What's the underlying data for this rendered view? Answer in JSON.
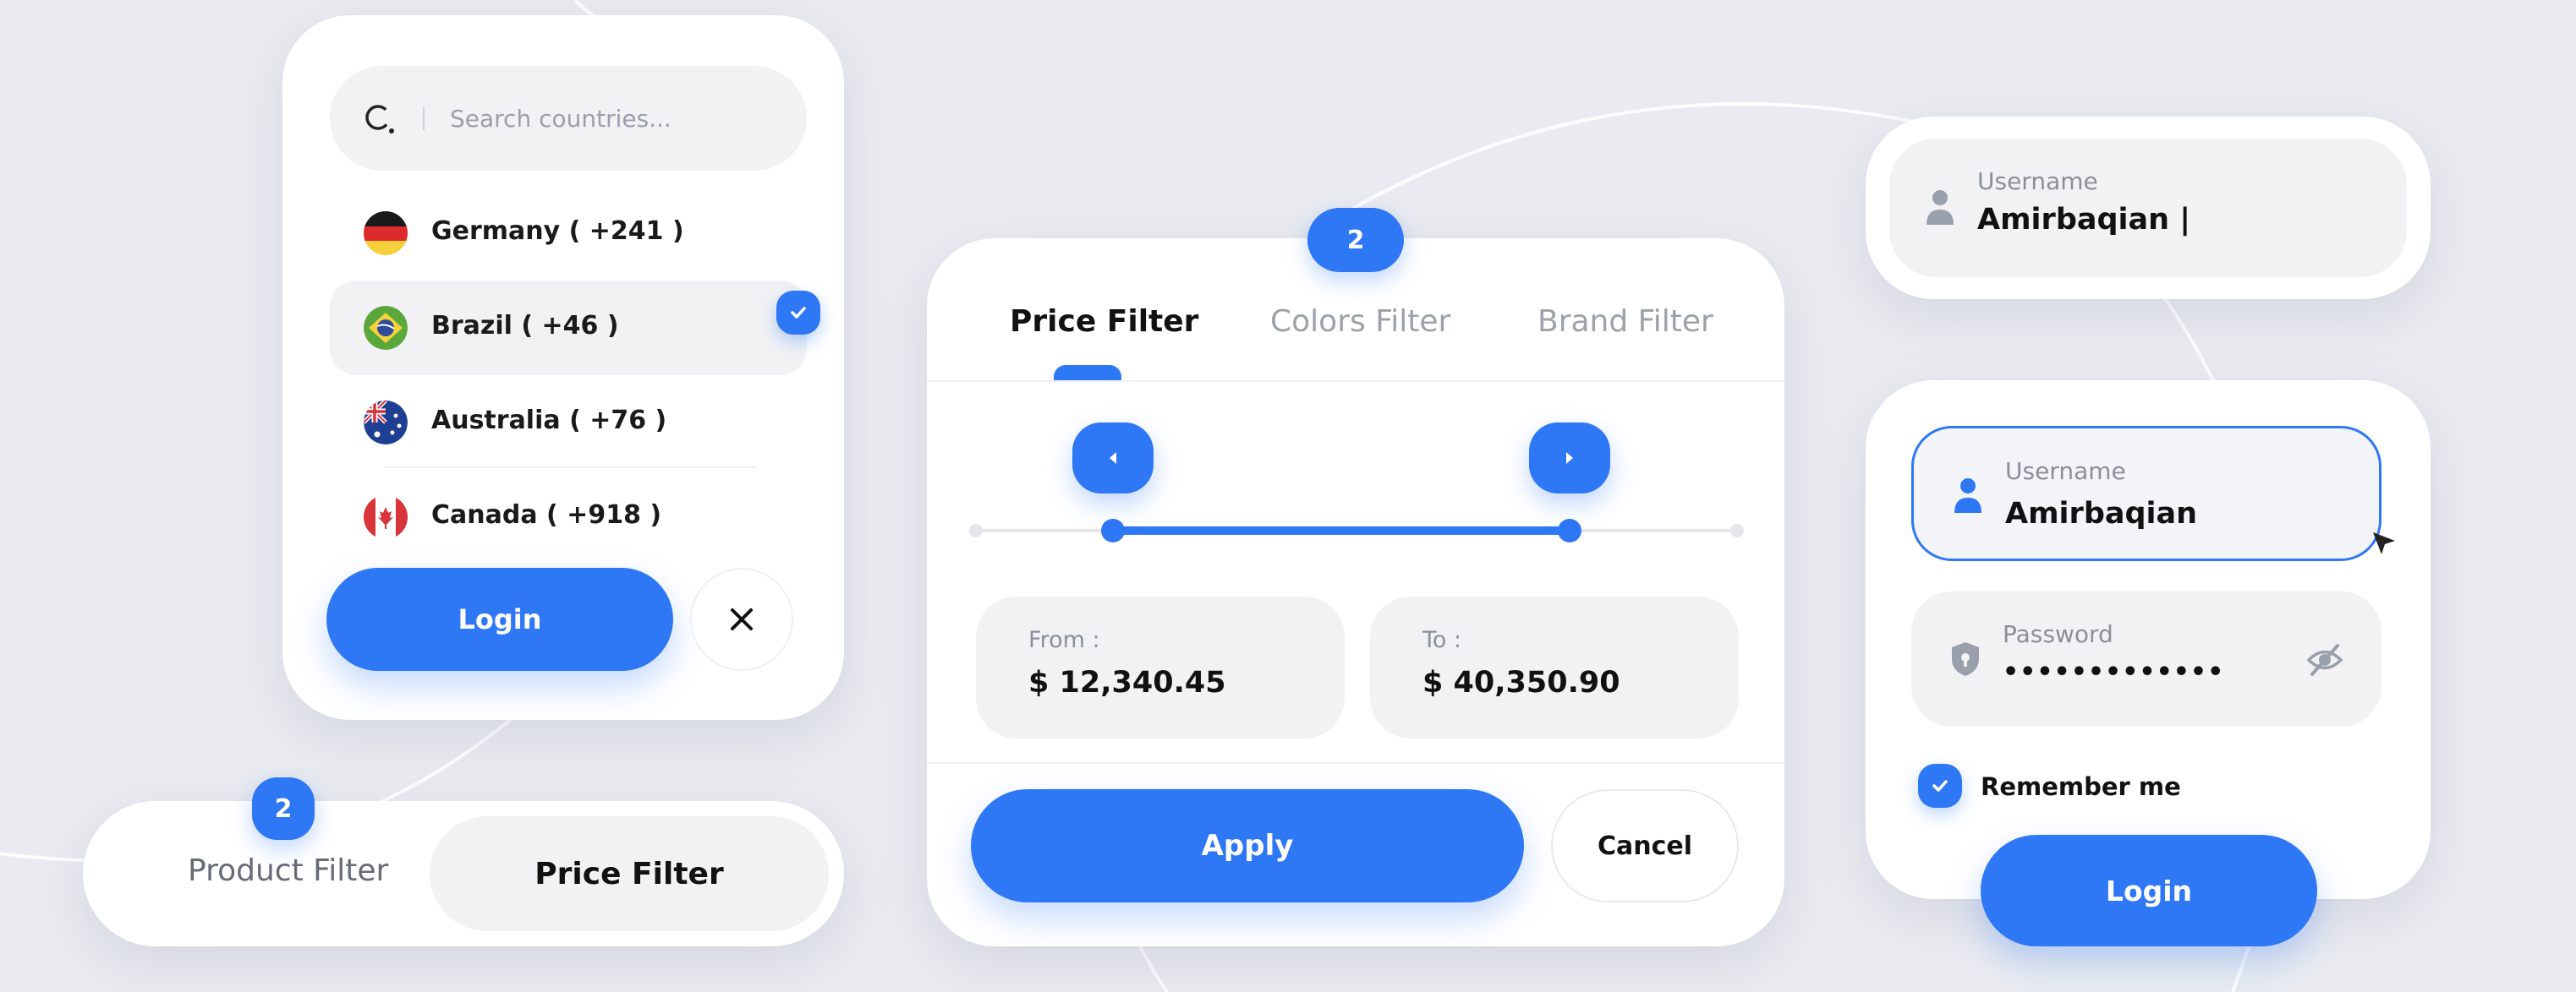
{
  "colors": {
    "accent": "#2e77f5",
    "background": "#e9ebf0",
    "card": "#ffffff",
    "field": "#f2f2f4",
    "muted_text": "#8a8f99",
    "text": "#111111"
  },
  "country_picker": {
    "search": {
      "placeholder": "Search countries...",
      "icon": "search-icon"
    },
    "countries": [
      {
        "label": "Germany ( +241 )",
        "flag": "germany-flag-icon",
        "selected": false
      },
      {
        "label": "Brazil ( +46 )",
        "flag": "brazil-flag-icon",
        "selected": true
      },
      {
        "label": "Australia ( +76 )",
        "flag": "australia-flag-icon",
        "selected": false
      },
      {
        "label": "Canada ( +918 )",
        "flag": "canada-flag-icon",
        "selected": false
      }
    ],
    "login_label": "Login",
    "close_icon": "close-icon",
    "selected_icon": "check-icon"
  },
  "segment_filter": {
    "badge": "2",
    "tabs": [
      {
        "label": "Product Filter",
        "active": false
      },
      {
        "label": "Price Filter",
        "active": true
      }
    ]
  },
  "price_filter": {
    "badge": "2",
    "tabs": [
      {
        "label": "Price Filter",
        "active": true
      },
      {
        "label": "Colors Filter",
        "active": false
      },
      {
        "label": "Brand Filter",
        "active": false
      }
    ],
    "slider": {
      "range_start": 0.18,
      "range_end": 0.78,
      "left_handle_icon": "chevron-left-icon",
      "right_handle_icon": "chevron-right-icon"
    },
    "from": {
      "caption": "From :",
      "value": "$ 12,340.45"
    },
    "to": {
      "caption": "To :",
      "value": "$ 40,350.90"
    },
    "apply_label": "Apply",
    "cancel_label": "Cancel"
  },
  "username_card": {
    "caption": "Username",
    "value": "Amirbaqian |",
    "icon": "user-icon"
  },
  "login_form": {
    "username": {
      "caption": "Username",
      "value": "Amirbaqian",
      "icon": "user-icon"
    },
    "password": {
      "caption": "Password",
      "value": "•••••••••••••",
      "icon": "shield-icon",
      "toggle_icon": "eye-off-icon"
    },
    "remember_label": "Remember me",
    "remember_checked": true,
    "login_label": "Login"
  }
}
